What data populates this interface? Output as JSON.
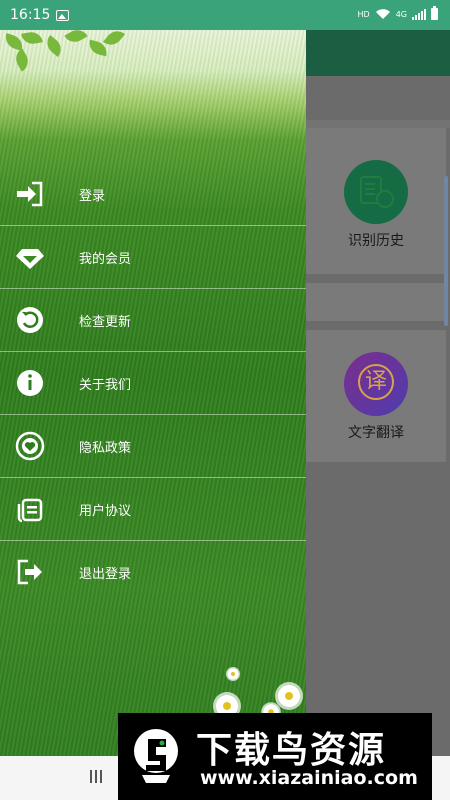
{
  "status_bar": {
    "time": "16:15",
    "hd": "HD",
    "network": "4G"
  },
  "drawer": {
    "menu": [
      {
        "label": "登录",
        "icon": "login-icon"
      },
      {
        "label": "我的会员",
        "icon": "diamond-icon"
      },
      {
        "label": "检查更新",
        "icon": "refresh-icon"
      },
      {
        "label": "关于我们",
        "icon": "info-icon"
      },
      {
        "label": "隐私政策",
        "icon": "privacy-icon"
      },
      {
        "label": "用户协议",
        "icon": "agreement-icon"
      },
      {
        "label": "退出登录",
        "icon": "logout-icon"
      }
    ]
  },
  "main": {
    "features": [
      {
        "label": "识别历史",
        "icon": "history-icon"
      },
      {
        "label": "文字翻译",
        "icon": "translate-icon"
      }
    ]
  },
  "watermark": {
    "title": "下载鸟资源",
    "url": "www.xiazainiao.com"
  },
  "colors": {
    "status_bar": "#3aa37a",
    "app_bar": "#1c5e42",
    "overlay": "#6b6b6b"
  }
}
